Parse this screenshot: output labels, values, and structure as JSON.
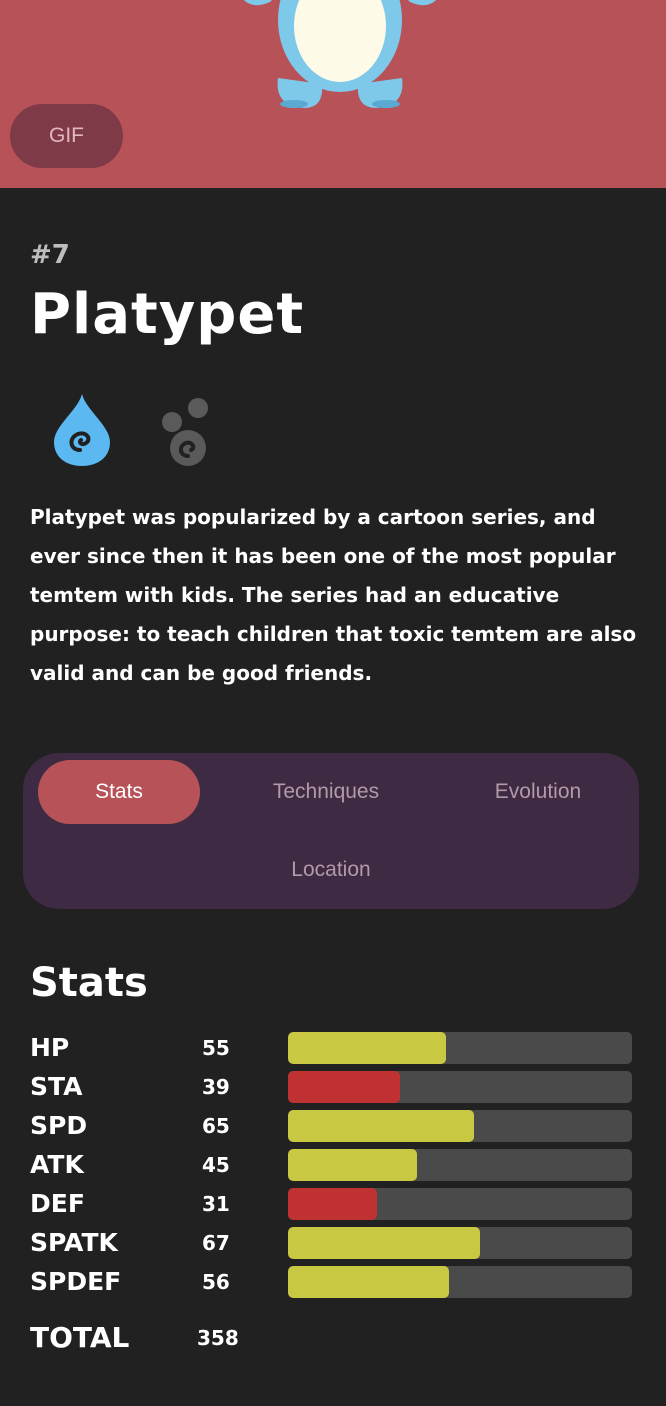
{
  "header": {
    "gif_label": "GIF",
    "background_color": "#b75358"
  },
  "monster": {
    "number": "#7",
    "name": "Platypet",
    "types": [
      {
        "icon": "water-drop-icon",
        "color": "#5bb8f0"
      },
      {
        "icon": "toxic-bubbles-icon",
        "color": "#5a5a5a"
      }
    ],
    "description": "Platypet was popularized by a cartoon series, and ever since then it has been one of the most popular temtem with kids. The series had an educative purpose: to teach children that toxic temtem are also valid and can be good friends."
  },
  "tabs": {
    "items": [
      {
        "label": "Stats",
        "active": true
      },
      {
        "label": "Techniques",
        "active": false
      },
      {
        "label": "Evolution",
        "active": false
      },
      {
        "label": "Location",
        "active": false
      }
    ]
  },
  "stats": {
    "title": "Stats",
    "max_value": 120,
    "colors": {
      "high": "#c9c842",
      "low": "#c03232",
      "track": "#4a4a4a"
    },
    "items": [
      {
        "label": "HP",
        "value": 55
      },
      {
        "label": "STA",
        "value": 39
      },
      {
        "label": "SPD",
        "value": 65
      },
      {
        "label": "ATK",
        "value": 45
      },
      {
        "label": "DEF",
        "value": 31
      },
      {
        "label": "SPATK",
        "value": 67
      },
      {
        "label": "SPDEF",
        "value": 56
      }
    ],
    "total_label": "TOTAL",
    "total_value": "358"
  }
}
